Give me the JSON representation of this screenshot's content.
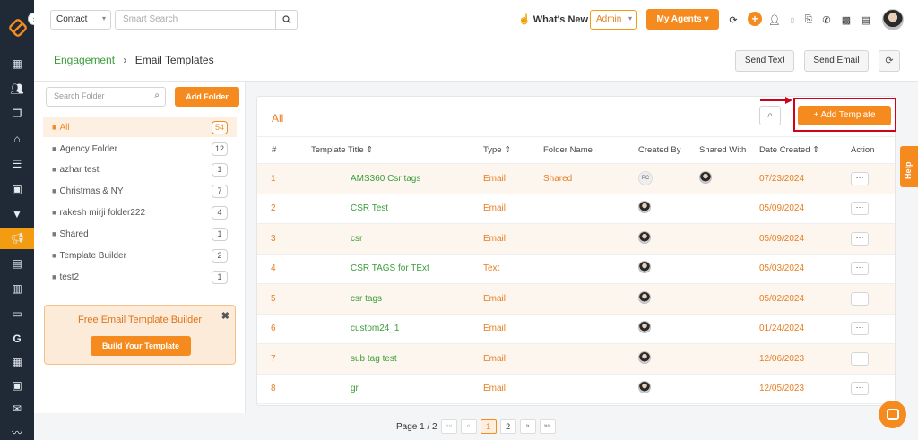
{
  "topbar": {
    "contact_select": "Contact",
    "search_placeholder": "Smart Search",
    "whats_new": "What's New",
    "role_select": "Admin",
    "my_agents": "My Agents"
  },
  "subheader": {
    "breadcrumb_parent": "Engagement",
    "breadcrumb_current": "Email Templates",
    "send_text": "Send Text",
    "send_email": "Send Email"
  },
  "folders": {
    "search_placeholder": "Search Folder",
    "add_folder": "Add Folder",
    "items": [
      {
        "label": "All",
        "count": "54"
      },
      {
        "label": "Agency Folder",
        "count": "12"
      },
      {
        "label": "azhar test",
        "count": "1"
      },
      {
        "label": "Christmas & NY",
        "count": "7"
      },
      {
        "label": "rakesh mirji folder222",
        "count": "4"
      },
      {
        "label": "Shared",
        "count": "1"
      },
      {
        "label": "Template Builder",
        "count": "2"
      },
      {
        "label": "test2",
        "count": "1"
      }
    ]
  },
  "promo": {
    "title": "Free Email Template Builder",
    "button": "Build Your Template"
  },
  "main": {
    "title": "All",
    "add_template": "+ Add Template",
    "columns": {
      "num": "#",
      "title": "Template Title ⇕",
      "type": "Type ⇕",
      "folder": "Folder Name",
      "created_by": "Created By",
      "shared_with": "Shared With",
      "date": "Date Created ⇕",
      "action": "Action"
    },
    "rows": [
      {
        "num": "1",
        "title": "AMS360 Csr tags",
        "type": "Email",
        "folder": "Shared",
        "created_by": "PC",
        "date": "07/23/2024"
      },
      {
        "num": "2",
        "title": "CSR Test",
        "type": "Email",
        "folder": "",
        "created_by": "",
        "date": "05/09/2024"
      },
      {
        "num": "3",
        "title": "csr",
        "type": "Email",
        "folder": "",
        "created_by": "",
        "date": "05/09/2024"
      },
      {
        "num": "4",
        "title": "CSR TAGS for TExt",
        "type": "Text",
        "folder": "",
        "created_by": "",
        "date": "05/03/2024"
      },
      {
        "num": "5",
        "title": "csr tags",
        "type": "Email",
        "folder": "",
        "created_by": "",
        "date": "05/02/2024"
      },
      {
        "num": "6",
        "title": "custom24_1",
        "type": "Email",
        "folder": "",
        "created_by": "",
        "date": "01/24/2024"
      },
      {
        "num": "7",
        "title": "sub tag test",
        "type": "Email",
        "folder": "",
        "created_by": "",
        "date": "12/06/2023"
      },
      {
        "num": "8",
        "title": "gr",
        "type": "Email",
        "folder": "",
        "created_by": "",
        "date": "12/05/2023"
      }
    ],
    "action_label": "⋯"
  },
  "pagination": {
    "label": "Page 1 / 2",
    "first": "««",
    "prev": "«",
    "page1": "1",
    "page2": "2",
    "next": "»",
    "last": "»»"
  },
  "help": "Help",
  "colors": {
    "accent": "#f58a1f",
    "nav_bg": "#1f2a36",
    "link_green": "#3a9d3a",
    "annotation_red": "#d0021b"
  }
}
